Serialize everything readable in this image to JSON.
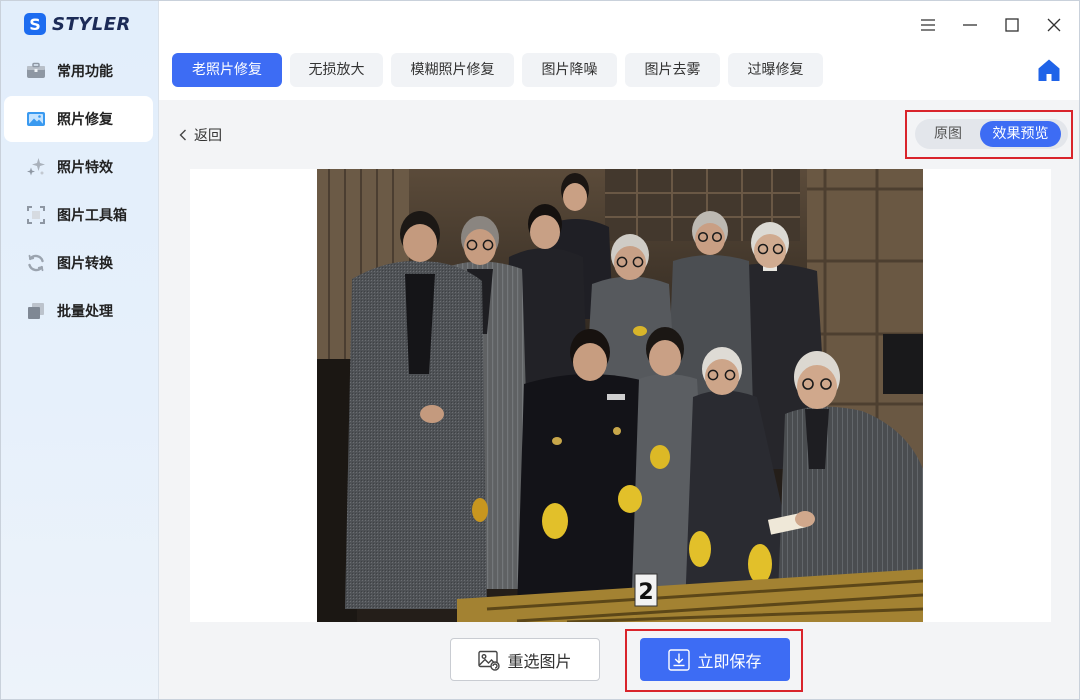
{
  "app": {
    "logo_letter": "S",
    "logo_text": "STYLER",
    "logo_icon": "styler-logo-icon"
  },
  "window_controls": {
    "icons": [
      "menu-icon",
      "minimize-icon",
      "maximize-icon",
      "close-icon"
    ]
  },
  "sidebar": {
    "selected_index": 1,
    "items": [
      {
        "label": "常用功能",
        "icon": "toolbox-icon"
      },
      {
        "label": "照片修复",
        "icon": "photo-repair-icon"
      },
      {
        "label": "照片特效",
        "icon": "sparkle-icon"
      },
      {
        "label": "图片工具箱",
        "icon": "crop-frame-icon"
      },
      {
        "label": "图片转换",
        "icon": "convert-icon"
      },
      {
        "label": "批量处理",
        "icon": "batch-stack-icon"
      }
    ]
  },
  "tabs": {
    "selected_index": 0,
    "items": [
      {
        "label": "老照片修复"
      },
      {
        "label": "无损放大"
      },
      {
        "label": "模糊照片修复"
      },
      {
        "label": "图片降噪"
      },
      {
        "label": "图片去雾"
      },
      {
        "label": "过曝修复"
      }
    ]
  },
  "home": {
    "icon": "home-icon"
  },
  "back": {
    "label": "返回",
    "icon": "chevron-left-icon"
  },
  "view_toggle": {
    "selected_index": 1,
    "options": [
      {
        "label": "原图"
      },
      {
        "label": "效果预览"
      }
    ]
  },
  "preview": {
    "marker_label": "2"
  },
  "actions": {
    "reselect": {
      "label": "重选图片",
      "icon": "image-reselect-icon"
    },
    "save": {
      "label": "立即保存",
      "icon": "download-icon"
    }
  },
  "colors": {
    "accent": "#3d6cf4",
    "highlight": "#d9242b",
    "sidebar_bg": "#e6f0fb",
    "content_bg": "#f3f4f6"
  }
}
